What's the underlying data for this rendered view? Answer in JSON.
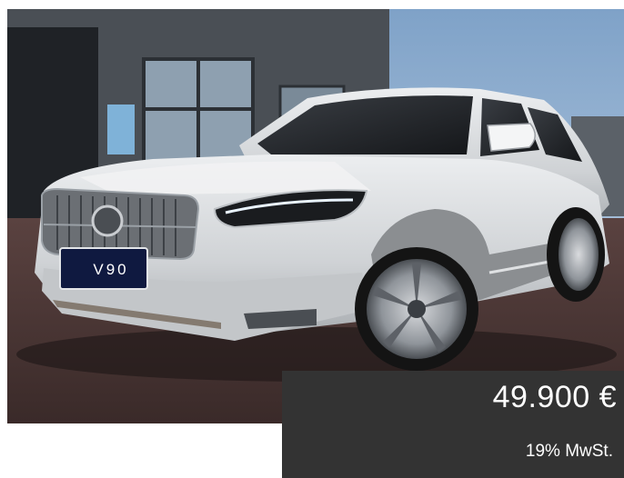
{
  "listing": {
    "image_alt": "Volvo V90 Cross Country",
    "plate_text": "V90",
    "price": "49.900 €",
    "vat_note": "19% MwSt."
  },
  "colors": {
    "price_panel_bg": "#333333",
    "price_text": "#ffffff",
    "car_body": "#d3d5d7"
  }
}
